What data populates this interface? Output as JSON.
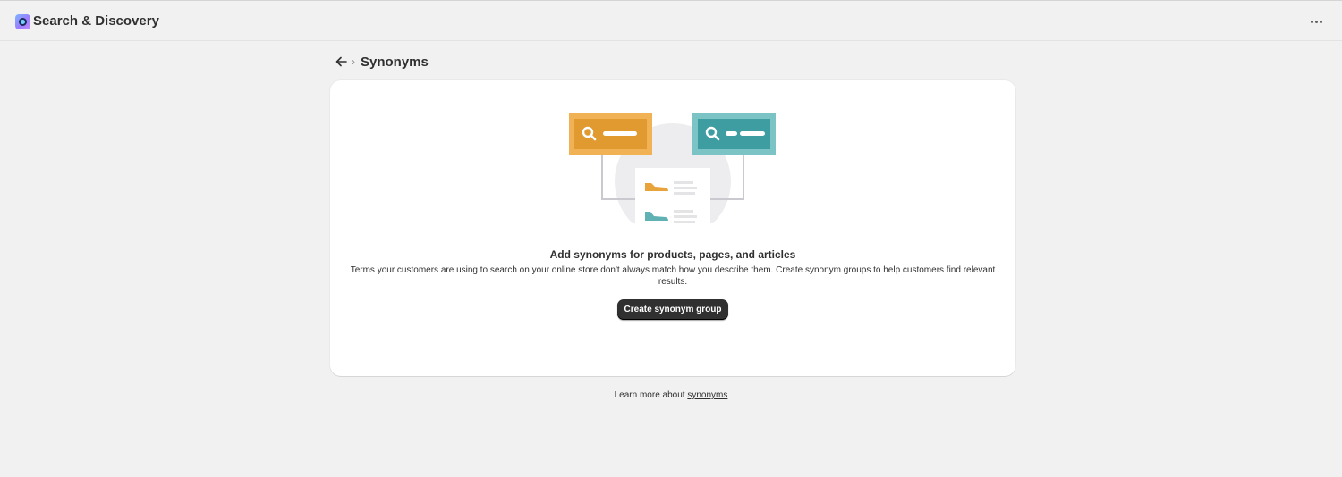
{
  "app": {
    "title": "Search & Discovery",
    "logo_icon": "search-discovery-app-icon",
    "more_icon": "more-horizontal-icon"
  },
  "header": {
    "back_icon": "arrow-left-icon",
    "separator": "›",
    "title": "Synonyms"
  },
  "empty_state": {
    "illustration_icon": "synonyms-illustration",
    "heading": "Add synonyms for products, pages, and articles",
    "body": "Terms your customers are using to search on your online store don't always match how you describe them. Create synonym groups to help customers find relevant results.",
    "button_label": "Create synonym group"
  },
  "footer": {
    "prefix": "Learn more about ",
    "link_label": "synonyms"
  },
  "colors": {
    "page_bg": "#f1f1f1",
    "card_bg": "#ffffff",
    "primary_button": "#303030",
    "illustration_orange": "#e8a43b",
    "illustration_teal": "#5fb1b3"
  }
}
